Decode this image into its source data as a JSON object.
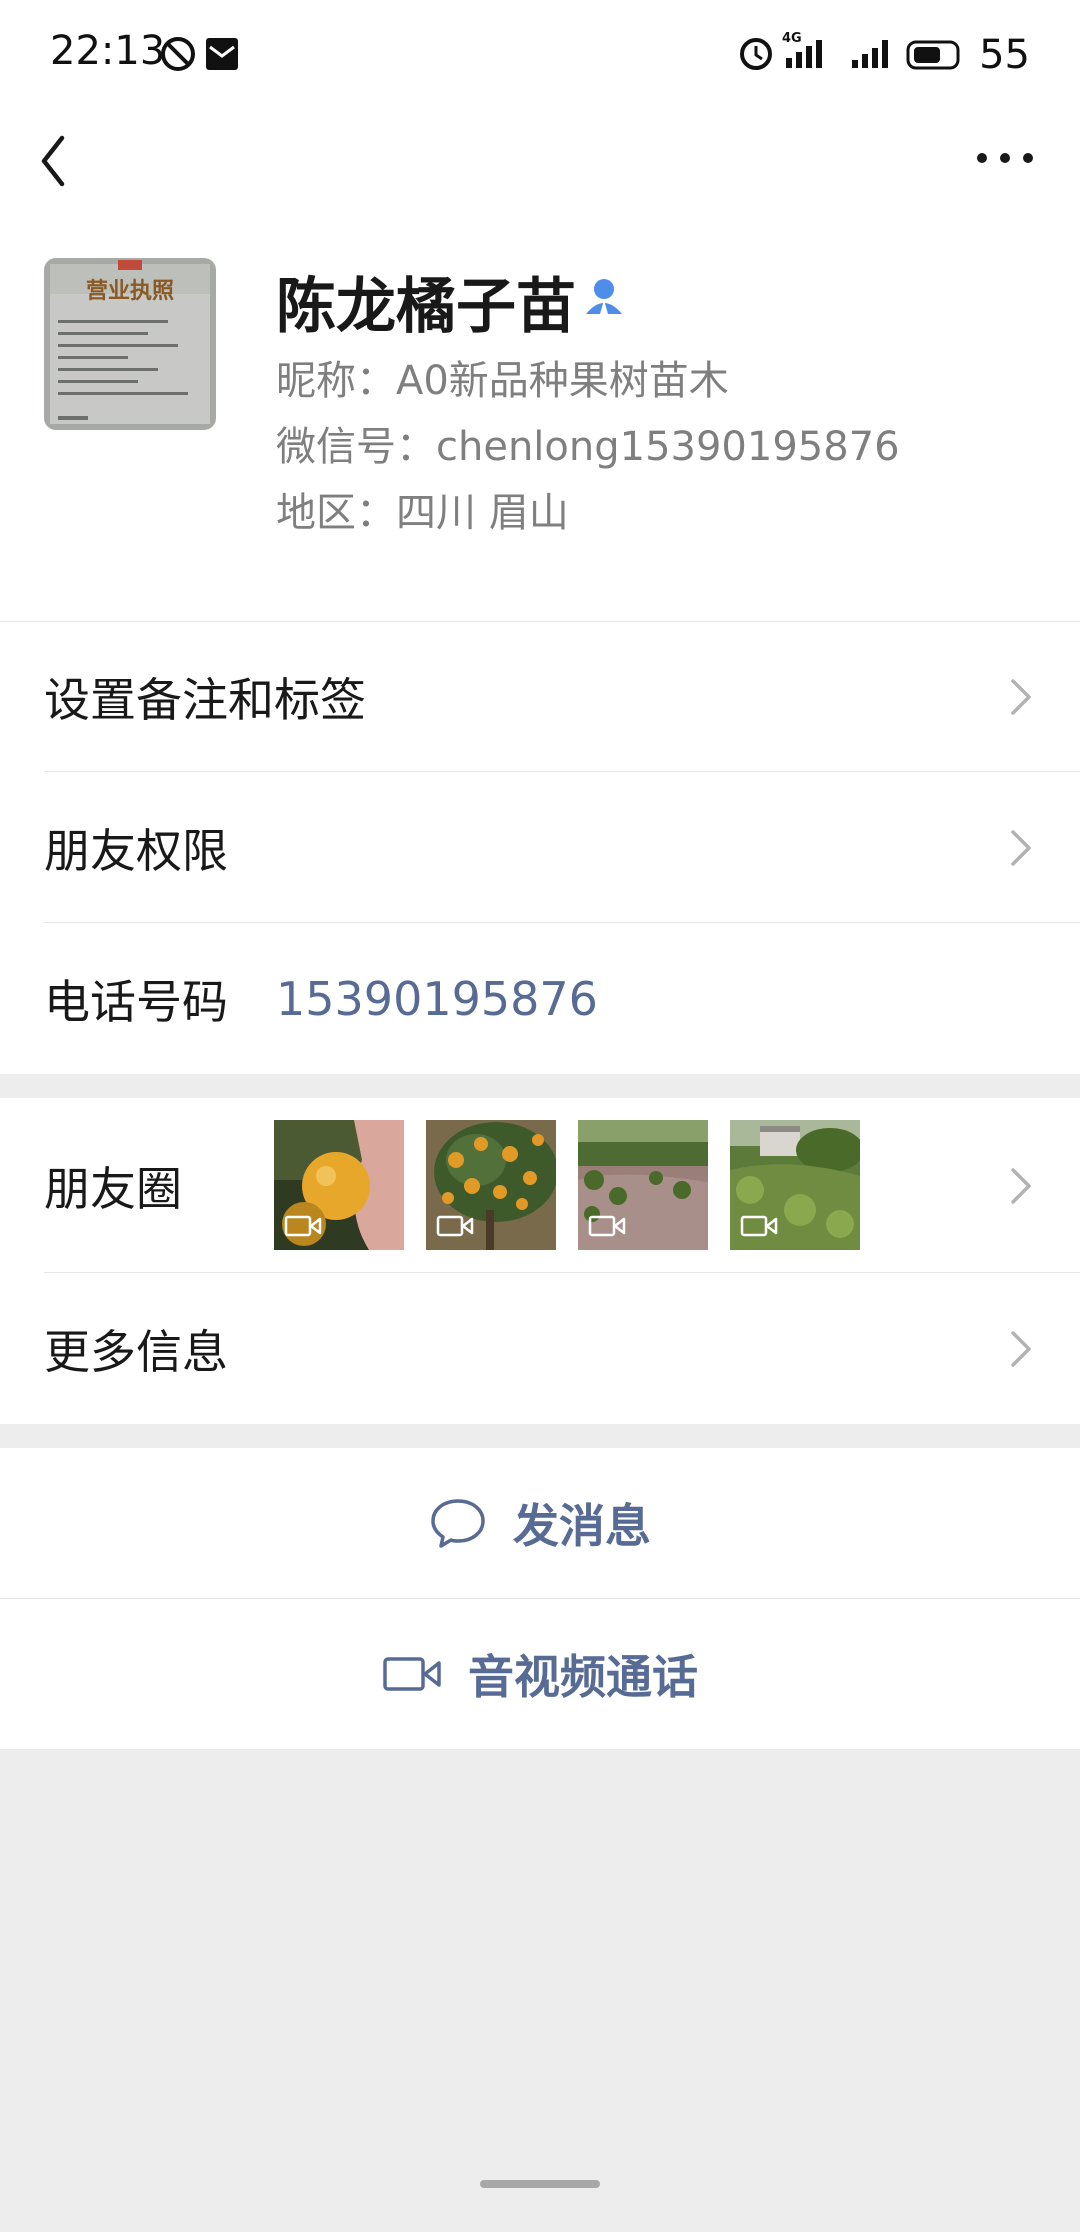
{
  "status_bar": {
    "time": "22:13",
    "network": "4G",
    "battery": "55"
  },
  "nav": {
    "back_icon": "chevron-left-icon",
    "more_icon": "more-dots-icon"
  },
  "profile": {
    "name": "陈龙橘子苗",
    "nickname": "昵称：A0新品种果树苗木",
    "wechat_id": "微信号：chenlong15390195876",
    "region": "地区：四川  眉山",
    "avatar_text": "营业执照"
  },
  "rows": {
    "remark_label": "设置备注和标签",
    "permission_label": "朋友权限",
    "phone_label": "电话号码",
    "phone_value": "15390195876",
    "moments_label": "朋友圈",
    "more_info_label": "更多信息"
  },
  "actions": {
    "message_label": "发消息",
    "call_label": "音视频通话"
  },
  "colors": {
    "link": "#576b95",
    "background": "#ededed",
    "verify": "#4f8ee8"
  }
}
